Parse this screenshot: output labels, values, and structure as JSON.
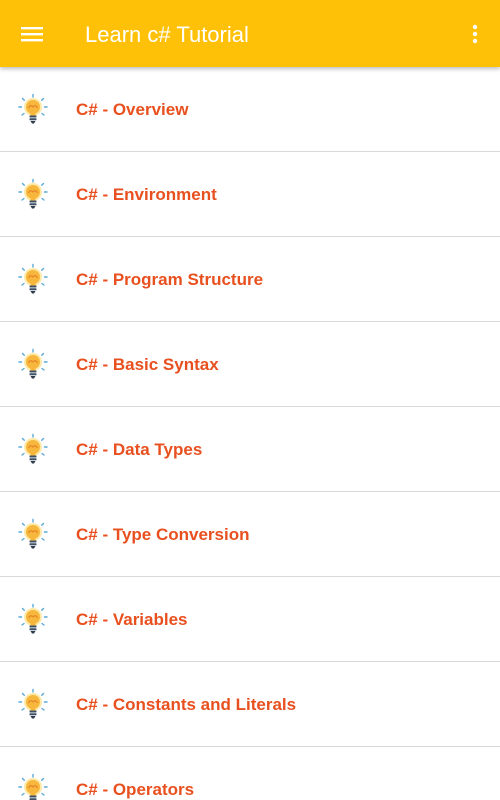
{
  "appbar": {
    "title": "Learn c# Tutorial",
    "menu_icon": "hamburger-menu-icon",
    "more_icon": "more-vert-icon",
    "color": "#FFC107"
  },
  "list": {
    "icon": "lightbulb-icon",
    "label_color": "#E8501F",
    "items": [
      {
        "label": "C# - Overview"
      },
      {
        "label": "C# - Environment"
      },
      {
        "label": "C# - Program Structure"
      },
      {
        "label": "C# - Basic Syntax"
      },
      {
        "label": "C# - Data Types"
      },
      {
        "label": "C# - Type Conversion"
      },
      {
        "label": "C# - Variables"
      },
      {
        "label": "C# - Constants and Literals"
      },
      {
        "label": "C# - Operators"
      }
    ]
  }
}
